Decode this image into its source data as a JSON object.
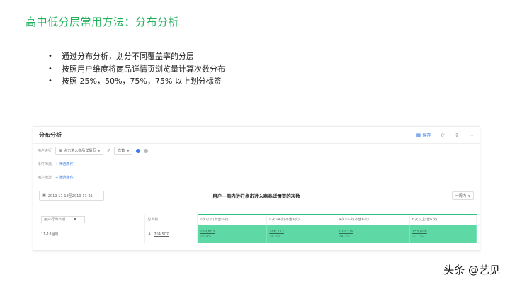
{
  "slide": {
    "title": "高中低分层常用方法：分布分析",
    "bullets": [
      "通过分布分析，划分不同覆盖率的分层",
      "按照用户维度将商品详情页浏览量计算次数分布",
      "按照 25%，50%，75%，75% 以上划分标签"
    ]
  },
  "panel": {
    "title": "分布分析",
    "save_label": "保存",
    "filters": {
      "user_behavior_label": "用户进行",
      "event_select": "点击进入商品详情页",
      "of_label": "的",
      "metric_select": "次数",
      "event_filter_label": "事件筛选",
      "user_filter_label": "用户筛选",
      "add_filter": "+ 筛选条件"
    },
    "toolbar": {
      "date_range": "2019-11-18至2019-11-21",
      "chart_title": "用户一周内进行点击进入商品详情页的次数",
      "period": "一周内"
    },
    "table": {
      "group_select": "用户行为日期",
      "total_header": "总人数",
      "bucket_headers": [
        "0次以下(不含0次)",
        "0次~4次(不含4次)",
        "4次~6次(不含6次)",
        "6次以上(含6次)"
      ],
      "row": {
        "label": "11-18当周",
        "total": "704,507",
        "buckets": [
          {
            "count": "189,803",
            "pct": "26.9%"
          },
          {
            "count": "186,712",
            "pct": "26.5%"
          },
          {
            "count": "170,379",
            "pct": "24.2%"
          },
          {
            "count": "155,608",
            "pct": "22.1%"
          }
        ]
      }
    }
  },
  "watermark": "头条 @艺见",
  "colors": {
    "title_green": "#1fb05a",
    "cell_green": "#5ed8a5",
    "link_blue": "#3b7de8"
  }
}
